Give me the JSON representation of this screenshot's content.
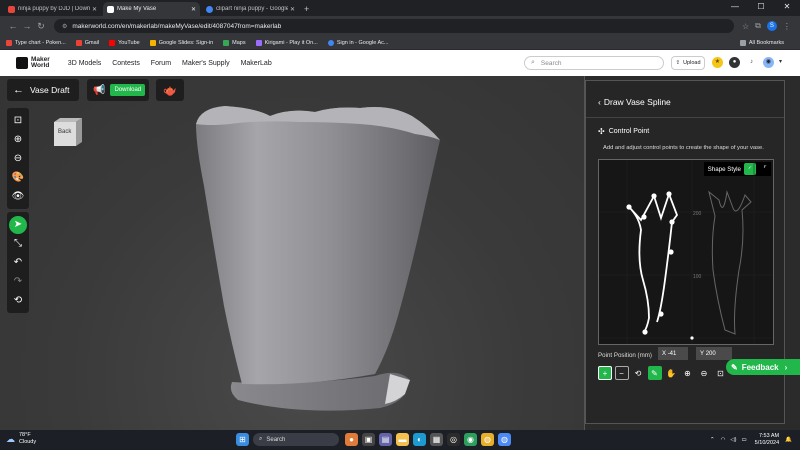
{
  "browser": {
    "tabs": [
      {
        "title": "ninja puppy by DJD | Downlo",
        "color": "#e8453c",
        "active": false
      },
      {
        "title": "Make My Vase",
        "color": "#111111",
        "active": true
      },
      {
        "title": "clipart ninja puppy - Google S",
        "color": "#4285f4",
        "active": false
      }
    ],
    "url": "makerworld.com/en/makerlab/makeMyVase/edit/4087047from=makerlab",
    "bookmarks": [
      "Type chart - Poken...",
      "Gmail",
      "YouTube",
      "Google Slides: Sign-in",
      "Maps",
      "Kirigami - Play it On...",
      "Sign in - Google Ac..."
    ],
    "all_bookmarks": "All Bookmarks",
    "new_tab": "+"
  },
  "site": {
    "logo_line1": "Maker",
    "logo_line2": "World",
    "nav": [
      "3D Models",
      "Contests",
      "Forum",
      "Maker's Supply",
      "MakerLab"
    ],
    "search_placeholder": "Search",
    "upload_label": "Upload"
  },
  "editor": {
    "title": "Vase Draft",
    "download_label": "Download",
    "cube_label": "Back"
  },
  "panel": {
    "title": "Draw Vase Spline",
    "section": "Control Point",
    "description": "Add and adjust control points to create the shape of your vase.",
    "shape_style": "Shape Style",
    "axis_ticks": [
      "200",
      "100"
    ],
    "point_position_label": "Point Position (mm)",
    "x_label": "X",
    "x_value": "-41",
    "y_label": "Y",
    "y_value": "200",
    "feedback_label": "Feedback",
    "accent": "#21b74b"
  },
  "taskbar": {
    "temp": "78°F",
    "weather": "Cloudy",
    "search": "Search",
    "time": "7:53 AM",
    "date": "5/10/2024"
  }
}
